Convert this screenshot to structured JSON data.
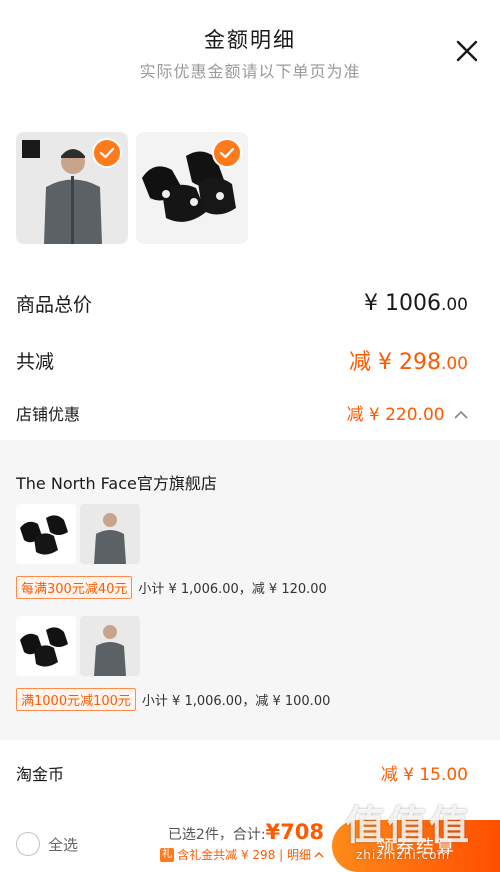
{
  "header": {
    "title": "金额明细",
    "subtitle": "实际优惠金额请以下单页为准"
  },
  "summary_rows": {
    "goods_total": {
      "label": "商品总价",
      "value_int": "¥ 1006",
      "value_dec": ".00"
    },
    "total_reduce": {
      "label": "共减",
      "value_int": "减 ¥ 298",
      "value_dec": ".00"
    },
    "store_discount": {
      "label": "店铺优惠",
      "value": "减 ¥ 220.00"
    }
  },
  "store": {
    "name": "The North Face官方旗舰店",
    "promos": [
      {
        "tag": "每满300元减40元",
        "subtotal": "小计 ¥ 1,006.00，减 ¥ 120.00"
      },
      {
        "tag": "满1000元减100元",
        "subtotal": "小计 ¥ 1,006.00，减 ¥ 100.00"
      }
    ]
  },
  "taojinbi": {
    "label": "淘金币",
    "value": "减 ¥ 15.00"
  },
  "footer": {
    "select_all": "全选",
    "selected_text": "已选2件，合计:",
    "total": "¥708",
    "gift_line": "含礼金共减 ¥ 298 | 明细",
    "checkout": "领券结算"
  },
  "watermark": {
    "main": "值值值",
    "sub": "zhizhizhi.com"
  },
  "colors": {
    "accent": "#ff5a00",
    "check": "#ff7a1a"
  },
  "icons": [
    "close-icon",
    "check-icon",
    "chevron-up-icon",
    "gift-icon"
  ]
}
